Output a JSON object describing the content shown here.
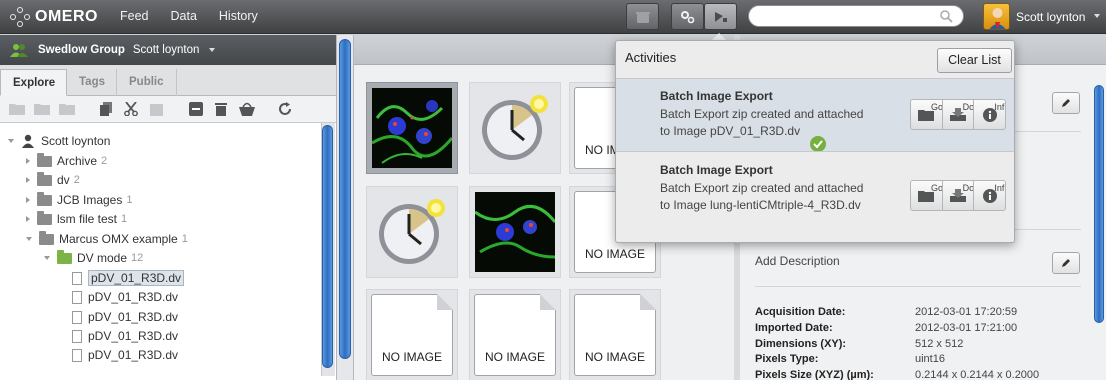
{
  "topbar": {
    "logo_text": "OMERO",
    "nav": [
      "Feed",
      "Data",
      "History"
    ],
    "search_placeholder": "",
    "user_name": "Scott loynton"
  },
  "left_panel": {
    "group_name": "Swedlow Group",
    "group_user": "Scott loynton",
    "tabs": [
      "Explore",
      "Tags",
      "Public"
    ],
    "active_tab": "Explore",
    "tree": {
      "root": "Scott loynton",
      "items": [
        {
          "label": "Archive",
          "count": "2"
        },
        {
          "label": "dv",
          "count": "2"
        },
        {
          "label": "JCB Images",
          "count": "1"
        },
        {
          "label": "lsm file test",
          "count": "1"
        },
        {
          "label": "Marcus OMX example",
          "count": "1"
        }
      ],
      "dataset": {
        "label": "DV mode",
        "count": "12"
      },
      "images": [
        "pDV_01_R3D.dv",
        "pDV_01_R3D.dv",
        "pDV_01_R3D.dv",
        "pDV_01_R3D.dv",
        "pDV_01_R3D.dv"
      ]
    }
  },
  "center_panel": {
    "no_image_label": "NO IMAGE"
  },
  "activities": {
    "title": "Activities",
    "clear_label": "Clear List",
    "items": [
      {
        "title": "Batch Image Export",
        "desc": "Batch Export zip created and attached to Image pDV_01_R3D.dv",
        "go_label": "Go",
        "download_label": "Do",
        "info_label": "Inf"
      },
      {
        "title": "Batch Image Export",
        "desc": "Batch Export zip created and attached to Image lung-lentiCMtriple-4_R3D.dv",
        "go_label": "Go",
        "download_label": "Do",
        "info_label": "Inf"
      }
    ]
  },
  "right_panel": {
    "add_description": "Add Description",
    "metadata": [
      {
        "key": "Acquisition Date:",
        "value": "2012-03-01 17:20:59"
      },
      {
        "key": "Imported Date:",
        "value": "2012-03-01 17:21:00"
      },
      {
        "key": "Dimensions (XY):",
        "value": "512 x 512"
      },
      {
        "key": "Pixels Type:",
        "value": "uint16"
      },
      {
        "key": "Pixels Size (XYZ) (µm):",
        "value": "0.2144 x 0.2144 x 0.2000"
      }
    ]
  },
  "colors": {
    "topbar": "#4f5154",
    "scroll_blue": "#2c6dc0",
    "success_green": "#76b041",
    "dataset_green": "#7bb347"
  }
}
